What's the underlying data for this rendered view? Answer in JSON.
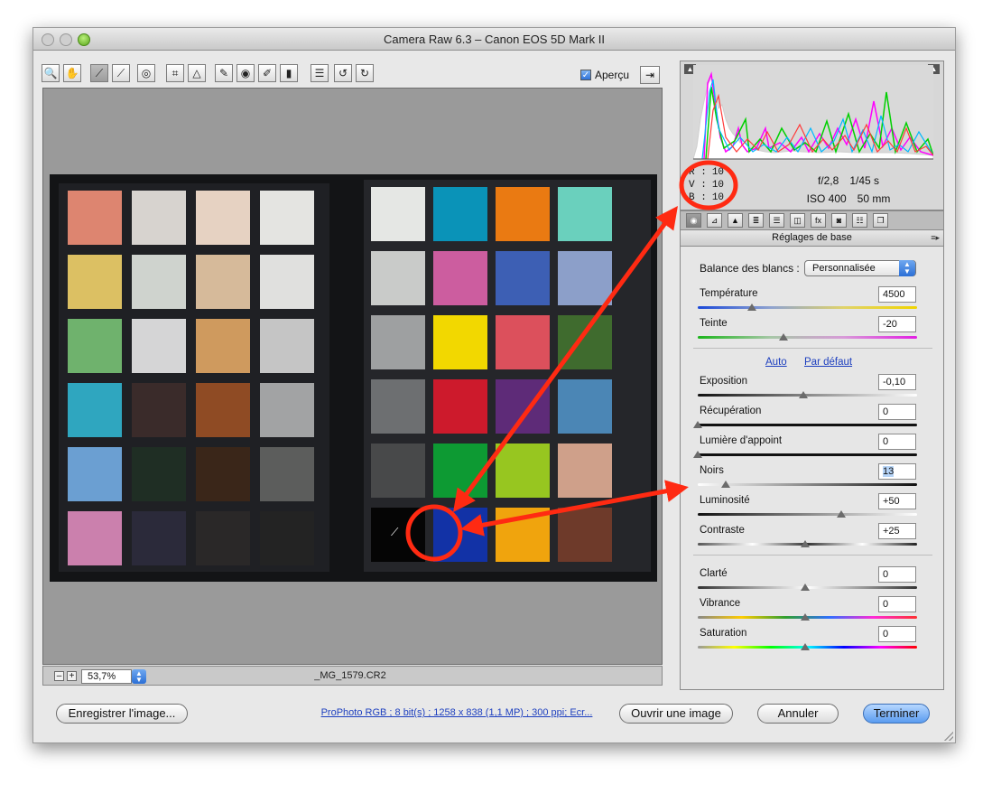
{
  "window": {
    "title": "Camera Raw 6.3  –  Canon EOS 5D Mark II"
  },
  "toolbar": {
    "tools": [
      {
        "name": "zoom-tool",
        "glyph": "🔍"
      },
      {
        "name": "hand-tool",
        "glyph": "✋"
      },
      {
        "name": "white-balance-tool",
        "glyph": "⟋"
      },
      {
        "name": "color-sampler-tool",
        "glyph": "⟋"
      },
      {
        "name": "targeted-adjustment-tool",
        "glyph": "◎"
      },
      {
        "name": "crop-tool",
        "glyph": "⌗"
      },
      {
        "name": "straighten-tool",
        "glyph": "△"
      },
      {
        "name": "spot-removal-tool",
        "glyph": "✎"
      },
      {
        "name": "red-eye-tool",
        "glyph": "◉"
      },
      {
        "name": "adjustment-brush-tool",
        "glyph": "✐"
      },
      {
        "name": "graduated-filter-tool",
        "glyph": "▮"
      },
      {
        "name": "preferences-tool",
        "glyph": "☰"
      },
      {
        "name": "rotate-left-tool",
        "glyph": "↺"
      },
      {
        "name": "rotate-right-tool",
        "glyph": "↻"
      }
    ],
    "preview_label": "Aperçu",
    "preview_checked": true
  },
  "status": {
    "zoom": "53,7%",
    "filename": "_MG_1579.CR2",
    "zoom_out": "–",
    "zoom_in": "+"
  },
  "readout": {
    "r_label": "R :",
    "r_value": "10",
    "v_label": "V :",
    "v_value": "10",
    "b_label": "B :",
    "b_value": "10",
    "aperture": "f/2,8",
    "shutter": "1/45 s",
    "iso": "ISO 400",
    "focal": "50 mm"
  },
  "panel": {
    "title": "Réglages de base",
    "menu_icon": "≡▸"
  },
  "tabs": [
    "◉",
    "⊿",
    "▲",
    "≣",
    "☰",
    "◫",
    "fx",
    "◙",
    "☷",
    "❐"
  ],
  "settings": {
    "wb_label": "Balance des blancs :",
    "wb_value": "Personnalisée",
    "auto_label": "Auto",
    "default_label": "Par défaut",
    "sliders": [
      {
        "id": "temperature",
        "label": "Température",
        "value": "4500",
        "level": 0.25
      },
      {
        "id": "teinte",
        "label": "Teinte",
        "value": "-20",
        "level": 0.4
      },
      {
        "id": "exposition",
        "label": "Exposition",
        "value": "-0,10",
        "level": 0.49
      },
      {
        "id": "recuperation",
        "label": "Récupération",
        "value": "0",
        "level": 0.0
      },
      {
        "id": "lumiere",
        "label": "Lumière d'appoint",
        "value": "0",
        "level": 0.0
      },
      {
        "id": "noirs",
        "label": "Noirs",
        "value": "13",
        "level": 0.13
      },
      {
        "id": "luminosite",
        "label": "Luminosité",
        "value": "+50",
        "level": 0.67
      },
      {
        "id": "contraste",
        "label": "Contraste",
        "value": "+25",
        "level": 0.5
      },
      {
        "id": "clarte",
        "label": "Clarté",
        "value": "0",
        "level": 0.5
      },
      {
        "id": "vibrance",
        "label": "Vibrance",
        "value": "0",
        "level": 0.5
      },
      {
        "id": "saturation",
        "label": "Saturation",
        "value": "0",
        "level": 0.5
      }
    ]
  },
  "buttons": {
    "save": "Enregistrer l'image...",
    "info": "ProPhoto RGB ; 8 bit(s) ; 1258 x 838 (1,1 MP) ; 300 ppi; Ecr...",
    "open": "Ouvrir une image",
    "cancel": "Annuler",
    "done": "Terminer"
  },
  "colors": {
    "accent": "#2b6fd6",
    "annotation": "#ff2a12"
  },
  "swatches_left": [
    [
      "#dd8570",
      "#d7d3cf",
      "#e6d2c2",
      "#e4e4e1"
    ],
    [
      "#dcc063",
      "#cfd3ce",
      "#d6ba9a",
      "#e0e0de"
    ],
    [
      "#6fb26d",
      "#d5d5d6",
      "#cf9a5e",
      "#c5c5c5"
    ],
    [
      "#2fa6bf",
      "#3a2b2a",
      "#8f4b24",
      "#a2a3a4"
    ],
    [
      "#6b9fd2",
      "#1f2e24",
      "#3a2619",
      "#5c5d5c"
    ],
    [
      "#cb80ad",
      "#2b2a3a",
      "#2a2828",
      "#232323"
    ]
  ],
  "swatches_right": [
    [
      "#e5e7e4",
      "#0a93b8",
      "#ea7a12",
      "#6ad0bd"
    ],
    [
      "#c9cbc9",
      "#cc5d9f",
      "#3d5fb4",
      "#8c9fc9"
    ],
    [
      "#9ea0a1",
      "#f2d800",
      "#dc505c",
      "#3f6b2e"
    ],
    [
      "#6d6f71",
      "#cd1a2c",
      "#5e2b78",
      "#4b86b5"
    ],
    [
      "#48494a",
      "#0d9a33",
      "#97c620",
      "#cfa08a"
    ],
    [
      "#050505",
      "#1232a6",
      "#f0a40d",
      "#6e3a2a"
    ]
  ]
}
